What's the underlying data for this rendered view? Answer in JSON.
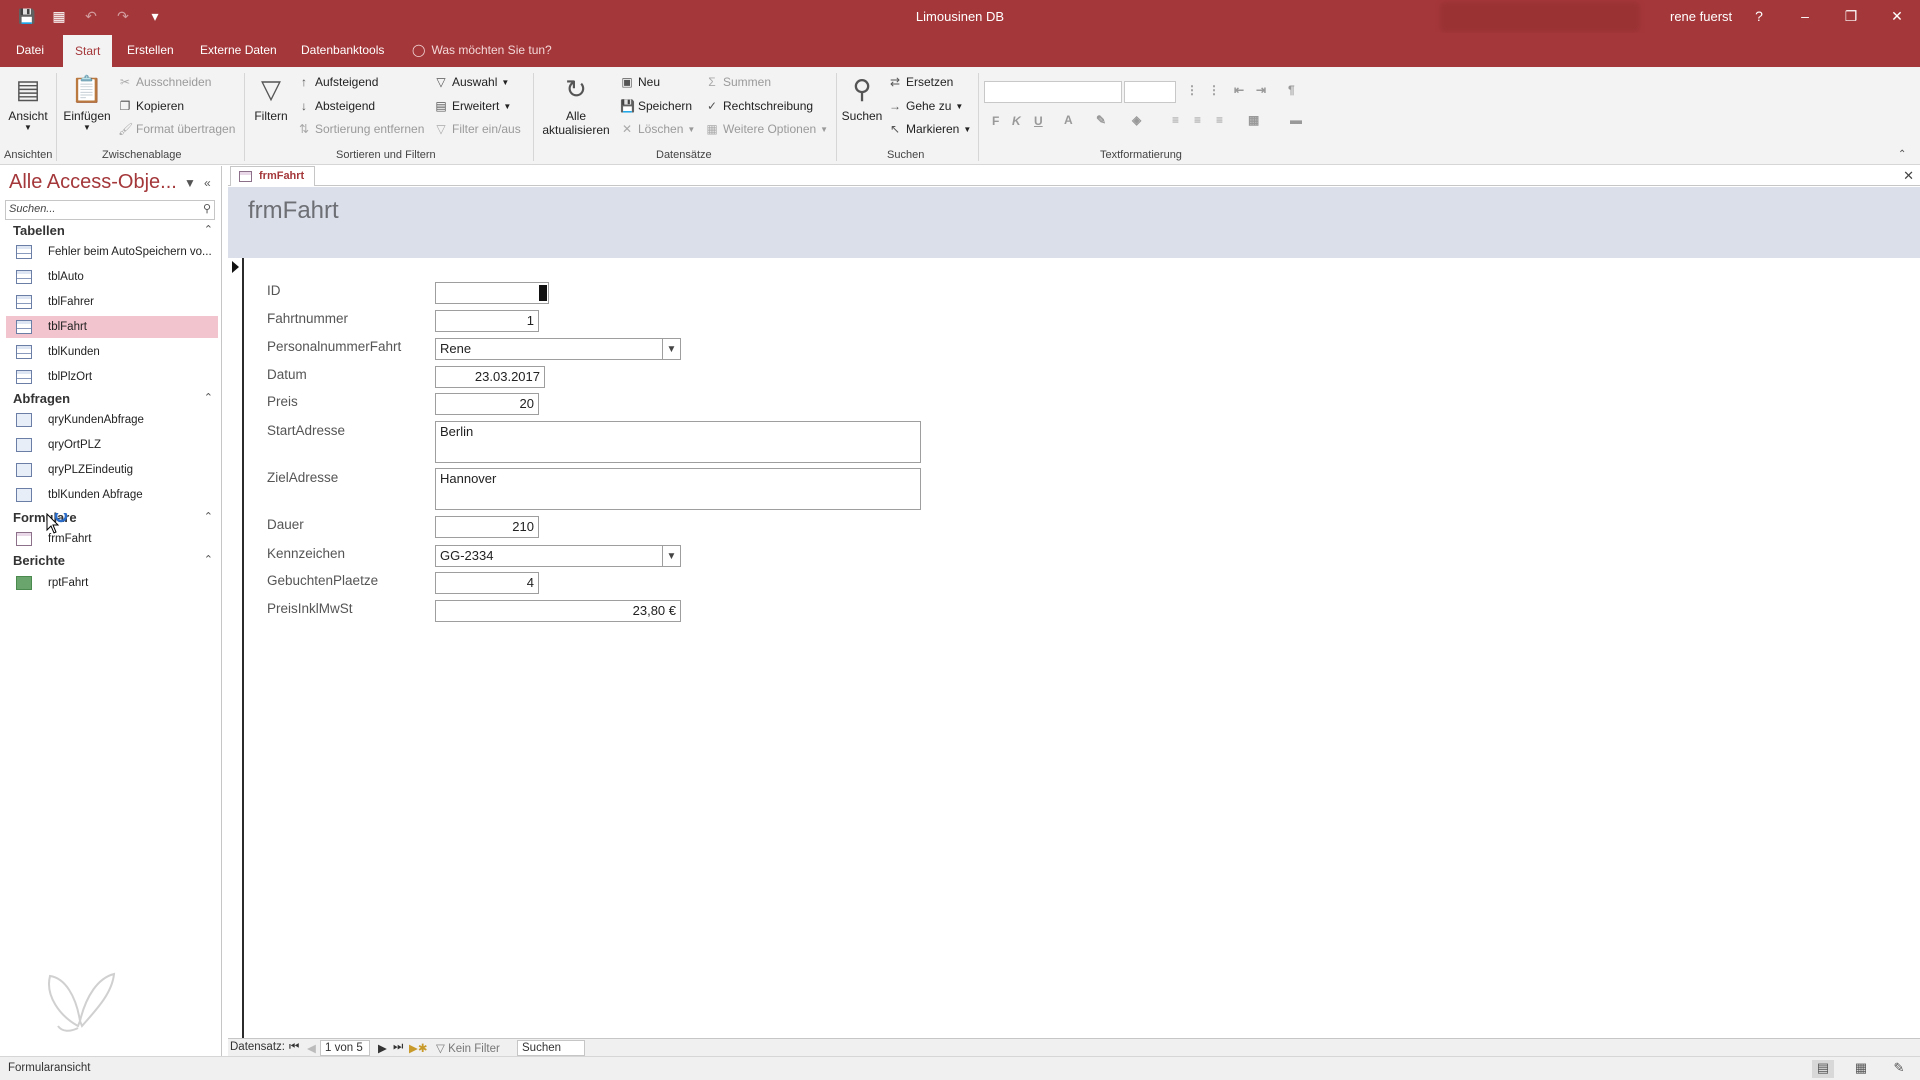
{
  "window": {
    "title": "Limousinen DB",
    "user": "rene fuerst",
    "help": "?",
    "minimize": "–",
    "restore": "❐",
    "close": "✕"
  },
  "qat": {
    "save": "💾",
    "grid": "▦",
    "undo": "↶",
    "redo": "↷",
    "customize": "▾"
  },
  "tabs": [
    "Datei",
    "Start",
    "Erstellen",
    "Externe Daten",
    "Datenbanktools"
  ],
  "tell_me": "Was möchten Sie tun?",
  "ribbon": {
    "ansicht": "Ansicht",
    "einfuegen": "Einfügen",
    "ausschneiden": "Ausschneiden",
    "kopieren": "Kopieren",
    "format_uebertragen": "Format übertragen",
    "filtern": "Filtern",
    "aufsteigend": "Aufsteigend",
    "absteigend": "Absteigend",
    "sortierung_entfernen": "Sortierung entfernen",
    "auswahl": "Auswahl",
    "erweitert": "Erweitert",
    "filter_ein_aus": "Filter ein/aus",
    "alle": "Alle",
    "aktualisieren": "aktualisieren",
    "neu": "Neu",
    "speichern": "Speichern",
    "loeschen": "Löschen",
    "summen": "Summen",
    "rechtschreibung": "Rechtschreibung",
    "weitere_optionen": "Weitere Optionen",
    "suchen": "Suchen",
    "ersetzen": "Ersetzen",
    "gehe_zu": "Gehe zu",
    "markieren": "Markieren",
    "bold": "F",
    "italic": "K",
    "underline": "U",
    "groups": {
      "ansichten": "Ansichten",
      "zwischenablage": "Zwischenablage",
      "sortieren": "Sortieren und Filtern",
      "datensaetze": "Datensätze",
      "suchen": "Suchen",
      "textformatierung": "Textformatierung"
    }
  },
  "nav": {
    "title": "Alle Access-Obje...",
    "search_placeholder": "Suchen...",
    "groups": {
      "tabellen": "Tabellen",
      "abfragen": "Abfragen",
      "formulare": "Formulare",
      "berichte": "Berichte"
    },
    "tabellen": [
      "Fehler beim AutoSpeichern vo...",
      "tblAuto",
      "tblFahrer",
      "tblFahrt",
      "tblKunden",
      "tblPlzOrt"
    ],
    "abfragen": [
      "qryKundenAbfrage",
      "qryOrtPLZ",
      "qryPLZEindeutig",
      "tblKunden Abfrage"
    ],
    "formulare": [
      "frmFahrt"
    ],
    "berichte": [
      "rptFahrt"
    ],
    "selected": "tblFahrt"
  },
  "document": {
    "tab": "frmFahrt",
    "form_title": "frmFahrt"
  },
  "fields": {
    "id": {
      "label": "ID",
      "value": ""
    },
    "fahrtnummer": {
      "label": "Fahrtnummer",
      "value": "1"
    },
    "personalnummer": {
      "label": "PersonalnummerFahrt",
      "value": "Rene"
    },
    "datum": {
      "label": "Datum",
      "value": "23.03.2017"
    },
    "preis": {
      "label": "Preis",
      "value": "20"
    },
    "startadresse": {
      "label": "StartAdresse",
      "value": "Berlin"
    },
    "zieladresse": {
      "label": "ZielAdresse",
      "value": "Hannover"
    },
    "dauer": {
      "label": "Dauer",
      "value": "210"
    },
    "kennzeichen": {
      "label": "Kennzeichen",
      "value": "GG-2334"
    },
    "gebuchteplaetze": {
      "label": "GebuchtenPlaetze",
      "value": "4"
    },
    "preisinklmwst": {
      "label": "PreisInklMwSt",
      "value": "23,80 €"
    }
  },
  "record_nav": {
    "label": "Datensatz:",
    "position": "1 von 5",
    "filter": "Kein Filter",
    "search": "Suchen"
  },
  "status": {
    "text": "Formularansicht"
  },
  "colors": {
    "brand": "#a4373a",
    "form_header": "#dbdfe9",
    "selected_item": "#f2c4ce"
  }
}
